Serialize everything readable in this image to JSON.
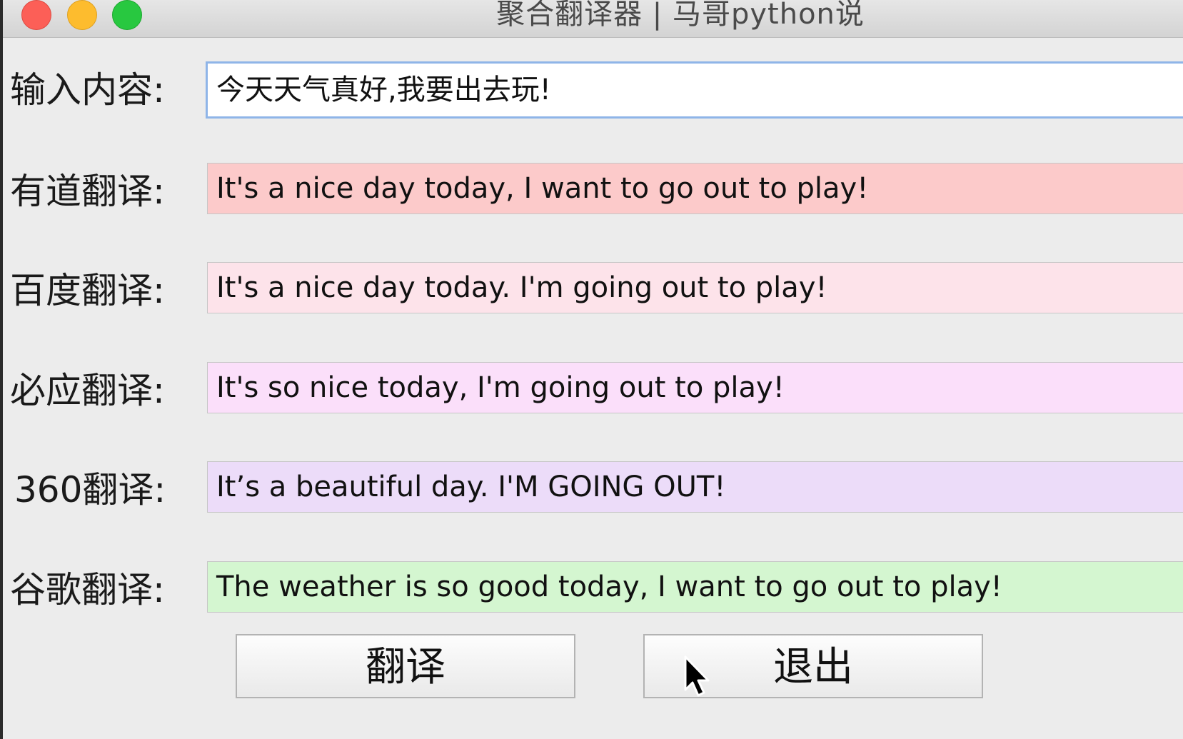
{
  "window": {
    "title": "聚合翻译器 | 马哥python说"
  },
  "input": {
    "label": "输入内容:",
    "value": "今天天气真好,我要出去玩!"
  },
  "results": [
    {
      "label": "有道翻译:",
      "text": "It's a nice day today, I want to go out to play!",
      "color": "#fccaca"
    },
    {
      "label": "百度翻译:",
      "text": "It's a nice day today. I'm going out to play!",
      "color": "#fde3ea"
    },
    {
      "label": "必应翻译:",
      "text": "It's so nice today, I'm going out to play!",
      "color": "#fbdffa"
    },
    {
      "label": "360翻译:",
      "text": "It’s a beautiful day. I'M GOING OUT!",
      "color": "#ecdcf9"
    },
    {
      "label": "谷歌翻译:",
      "text": "The weather is so good today, I want to go out to play!",
      "color": "#d4f6d0"
    }
  ],
  "buttons": {
    "translate": "翻译",
    "quit": "退出"
  }
}
